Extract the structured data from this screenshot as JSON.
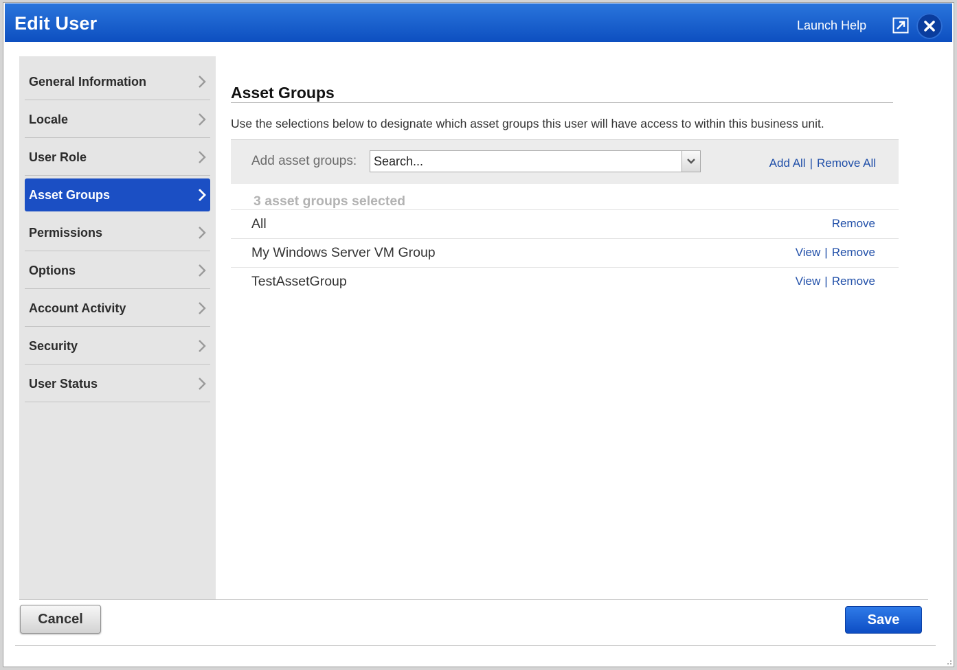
{
  "window": {
    "title": "Edit User",
    "launch_help": "Launch Help"
  },
  "sidebar": {
    "items": [
      {
        "label": "General Information"
      },
      {
        "label": "Locale"
      },
      {
        "label": "User Role"
      },
      {
        "label": "Asset Groups",
        "active": true
      },
      {
        "label": "Permissions"
      },
      {
        "label": "Options"
      },
      {
        "label": "Account Activity"
      },
      {
        "label": "Security"
      },
      {
        "label": "User Status"
      }
    ]
  },
  "main": {
    "title": "Asset Groups",
    "description": "Use the selections below to designate which asset groups this user will have access to within this business unit.",
    "add_label": "Add asset groups:",
    "search_placeholder": "Search...",
    "add_all": "Add All",
    "separator": "|",
    "remove_all": "Remove All",
    "selected_count": "3 asset groups selected",
    "groups": [
      {
        "name": "All",
        "remove": "Remove"
      },
      {
        "name": "My Windows Server VM Group",
        "view": "View",
        "remove": "Remove"
      },
      {
        "name": "TestAssetGroup",
        "view": "View",
        "remove": "Remove"
      }
    ]
  },
  "footer": {
    "cancel": "Cancel",
    "save": "Save"
  },
  "colors": {
    "title_bar": "#0d4fc0",
    "active_nav": "#1b4fc4",
    "link": "#1f4ea8",
    "sidebar_bg": "#e5e5e5"
  }
}
